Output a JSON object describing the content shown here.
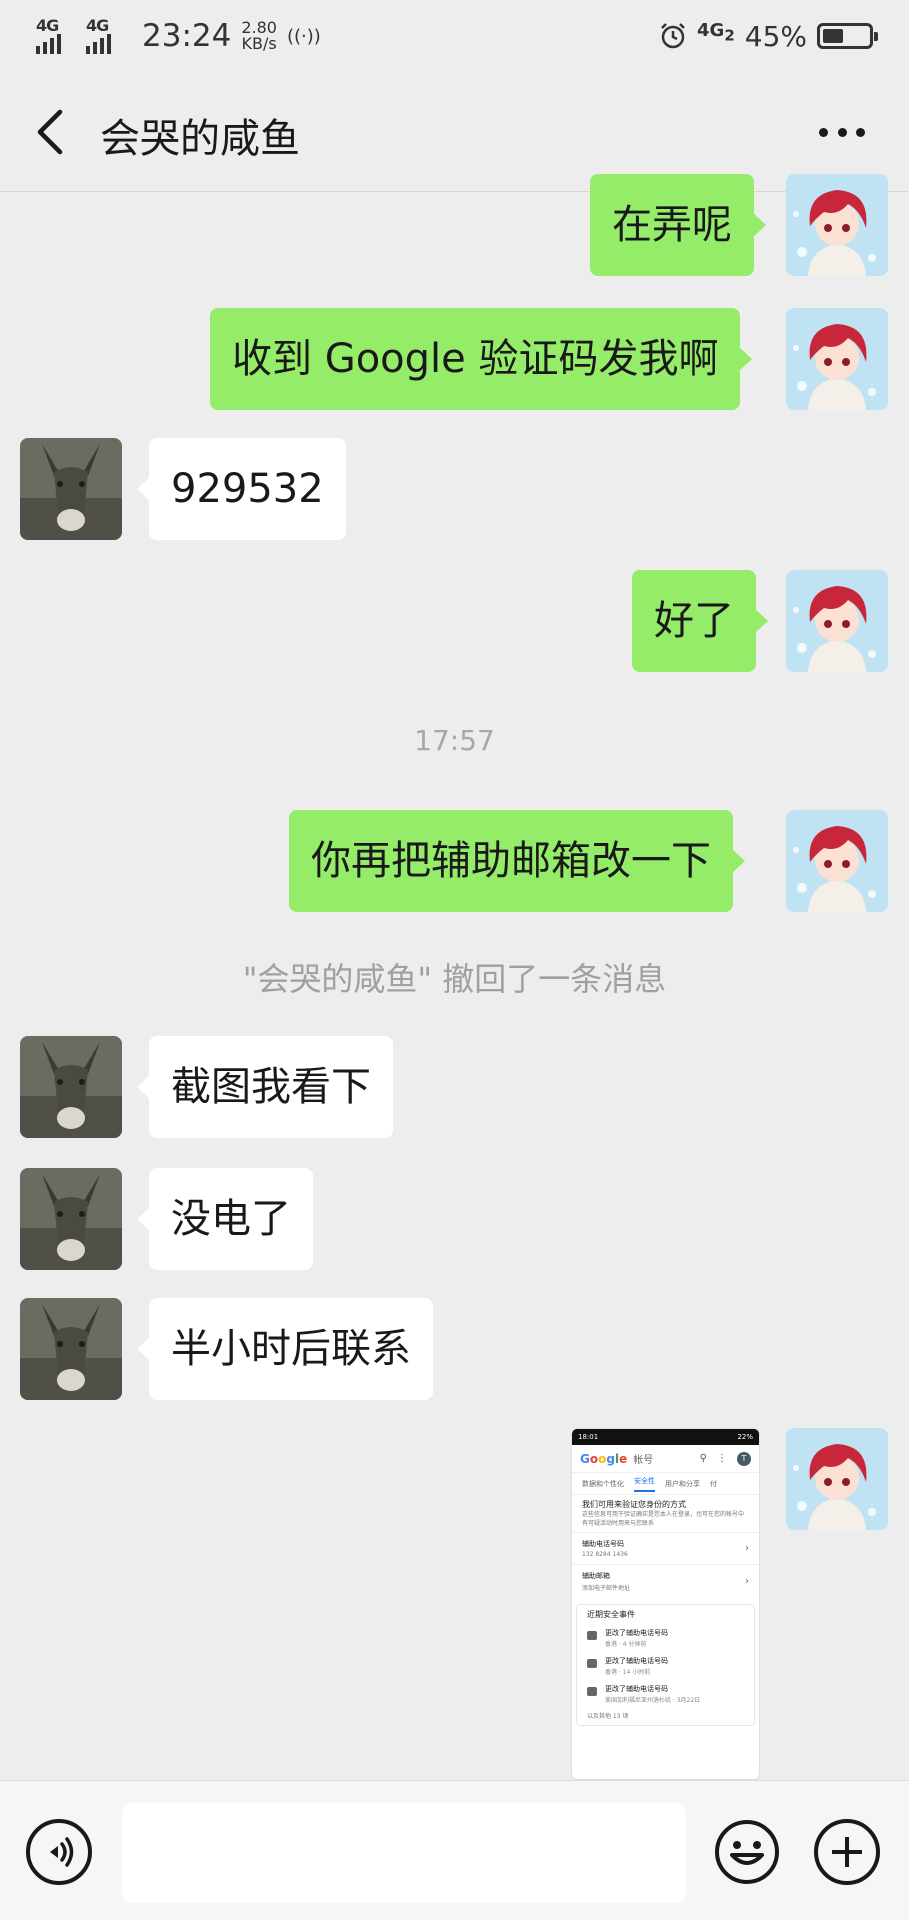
{
  "status_bar": {
    "network_left_1": "4G",
    "network_left_2": "4G",
    "time": "23:24",
    "speed_value": "2.80",
    "speed_unit": "KB/s",
    "hotspot_glyph": "((·))",
    "network_right": "4G",
    "network_right_sub": "2",
    "battery_percent": "45%",
    "battery_level": 0.45
  },
  "header": {
    "title": "会哭的咸鱼"
  },
  "messages": [
    {
      "side": "right",
      "text": "在弄呢"
    },
    {
      "side": "right",
      "text": "收到 Google 验证码发我啊"
    },
    {
      "side": "left",
      "text": "929532"
    },
    {
      "side": "right",
      "text": "好了"
    },
    {
      "side": "right",
      "text": "你再把辅助邮箱改一下"
    },
    {
      "side": "left",
      "text": "截图我看下"
    },
    {
      "side": "left",
      "text": "没电了"
    },
    {
      "side": "left",
      "text": "半小时后联系"
    }
  ],
  "timestamp": "17:57",
  "recall_notice": "\"会哭的咸鱼\" 撤回了一条消息",
  "screenshot_image": {
    "status_time": "18:01",
    "status_battery": "22%",
    "logo_letters": [
      "G",
      "o",
      "o",
      "g",
      "l",
      "e"
    ],
    "account_label": "帐号",
    "avatar_letter": "T",
    "tabs": [
      "数据和个性化",
      "安全性",
      "用户和分享",
      "付"
    ],
    "section_title": "我们可用来验证您身份的方式",
    "section_sub": "这些信息可用于验证确实是您本人在登录，也可在您的帐号中有可疑活动时用来与您联系",
    "rows": [
      {
        "label": "辅助电话号码",
        "value": "132 8284 1436"
      },
      {
        "label": "辅助邮箱",
        "value": "添加电子邮件地址"
      }
    ],
    "events_title": "近期安全事件",
    "events": [
      {
        "label": "更改了辅助电话号码",
        "value": "香港 · 4 分钟前"
      },
      {
        "label": "更改了辅助电话号码",
        "value": "香港 · 14 小时前"
      },
      {
        "label": "更改了辅助电话号码",
        "value": "美国加利福尼亚州洛杉矶 · 3月22日"
      }
    ],
    "footer": "以及其他 13 项"
  },
  "input_bar": {
    "placeholder": ""
  },
  "icons": {
    "back": "chevron-left-icon",
    "more": "more-dots-icon",
    "voice": "voice-icon",
    "emoji": "emoji-icon",
    "plus": "plus-icon"
  }
}
